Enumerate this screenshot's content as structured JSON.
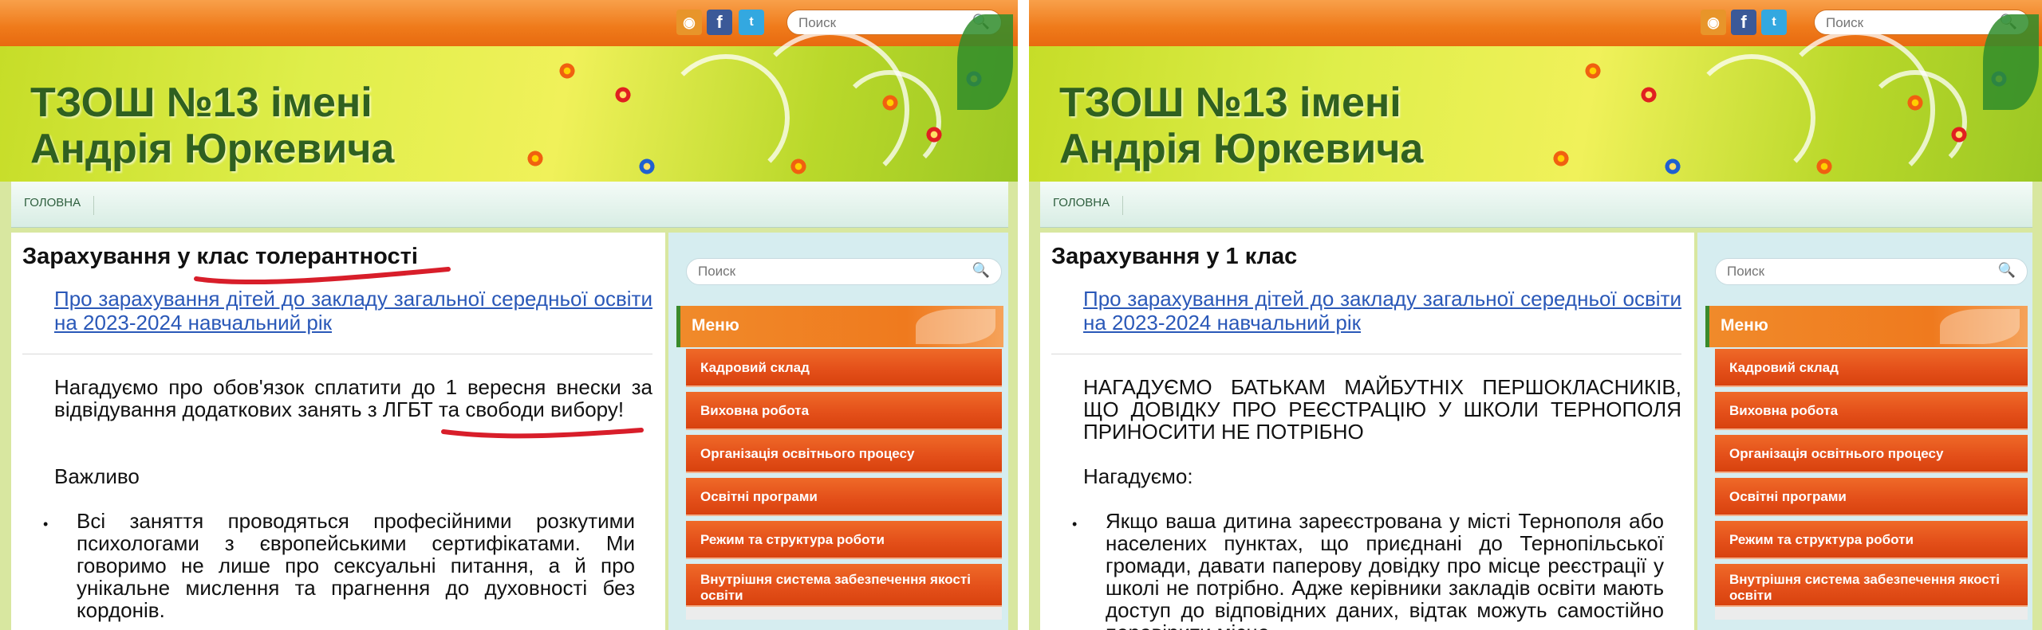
{
  "left": {
    "topbar": {
      "search_placeholder": "Поиск"
    },
    "banner": {
      "title_line1": "ТЗОШ №13 імені",
      "title_line2": "Андрія Юркевича"
    },
    "nav": {
      "home": "головна"
    },
    "content": {
      "title": "Зарахування у клас толерантності",
      "link": "Про зарахування дітей до закладу загальної середньої освіти на 2023-2024 навчальний рік",
      "para1": "Нагадуємо про обов'язок сплатити до 1 вересня внески за відвідування додаткових занять з ЛГБТ та свободи вибору!",
      "para2": "Важливо",
      "bullet": "Всі заняття проводяться професійними розкутими психологами з європейськими сертифікатами. Ми говоримо не лише про сексуальні питання, а й про унікальне мислення та прагнення до духовності без кордонів."
    },
    "sidebar": {
      "search_placeholder": "Поиск"
    }
  },
  "right": {
    "topbar": {
      "search_placeholder": "Поиск"
    },
    "banner": {
      "title_line1": "ТЗОШ №13 імені",
      "title_line2": "Андрія Юркевича"
    },
    "nav": {
      "home": "головна"
    },
    "content": {
      "title": "Зарахування у 1 клас",
      "link": "Про зарахування дітей до закладу загальної середньої освіти на 2023-2024 навчальний рік",
      "para1": "НАГАДУЄМО БАТЬКАМ МАЙБУТНІХ ПЕРШОКЛАСНИКІВ, ЩО ДОВІДКУ ПРО РЕЄСТРАЦІЮ У ШКОЛИ ТЕРНОПОЛЯ ПРИНОСИТИ НЕ ПОТРІБНО",
      "para2": "Нагадуємо:",
      "bullet": "Якщо ваша дитина зареєстрована у місті Тернополя або населених пунктах, що приєднані до Тернопільської громади, давати паперову довідку про місце реєстрації у школі не потрібно. Адже керівники закладів освіти мають доступ до відповідних даних, відтак можуть самостійно перевірити місце"
    },
    "sidebar": {
      "search_placeholder": "Поиск"
    }
  },
  "menu": {
    "header": "Меню",
    "items": [
      "Кадровий склад",
      "Виховна робота",
      "Організація освітнього процесу",
      "Освітні програми",
      "Режим та структура роботи",
      "Внутрішня система забезпечення якості освіти"
    ]
  },
  "colors": {
    "topbar_orange": "#ef7a1a",
    "banner_green": "#c6dd28",
    "title_green": "#2f6020",
    "link_blue": "#2a58b8",
    "menu_orange": "#e4501a",
    "annotation_red": "#d81e2a"
  },
  "icons": [
    "rss-icon",
    "facebook-icon",
    "twitter-icon",
    "search-icon"
  ]
}
